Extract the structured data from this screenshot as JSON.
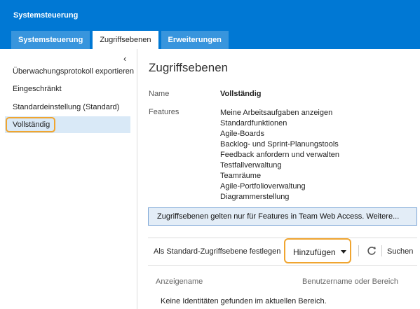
{
  "app": {
    "title": "Systemsteuerung"
  },
  "tabs": [
    {
      "label": "Systemsteuerung",
      "active": false
    },
    {
      "label": "Zugriffsebenen",
      "active": true
    },
    {
      "label": "Erweiterungen",
      "active": false
    }
  ],
  "sidebar": {
    "collapse_icon": "chevron-left",
    "items": [
      {
        "label": "Überwachungsprotokoll exportieren"
      },
      {
        "label": "Eingeschränkt"
      },
      {
        "label": "Standardeinstellung (Standard)"
      },
      {
        "label": "Vollständig",
        "selected": true
      }
    ]
  },
  "main": {
    "title": "Zugriffsebenen",
    "name_label": "Name",
    "name_value": "Vollständig",
    "features_label": "Features",
    "features": [
      "Meine Arbeitsaufgaben anzeigen",
      "Standardfunktionen",
      "Agile-Boards",
      "Backlog- und Sprint-Planungstools",
      "Feedback anfordern und verwalten",
      "Testfallverwaltung",
      "Teamräume",
      "Agile-Portfolioverwaltung",
      "Diagrammerstellung"
    ],
    "info_message": "Zugriffsebenen gelten nur für Features in Team Web Access. Weitere..."
  },
  "toolbar": {
    "set_default": "Als Standard-Zugriffsebene festlegen",
    "add": "Hinzufügen",
    "search": "Suchen",
    "refresh_icon": "refresh"
  },
  "table": {
    "columns": [
      "Anzeigename",
      "Benutzername oder Bereich"
    ],
    "empty_message": "Keine Identitäten gefunden im aktuellen Bereich."
  },
  "colors": {
    "header_blue": "#0078d4",
    "tab_blue": "#3895dd",
    "selected_bg": "#d9e9f7",
    "highlight_orange": "#f0a530",
    "info_bg": "#e3edf7"
  }
}
